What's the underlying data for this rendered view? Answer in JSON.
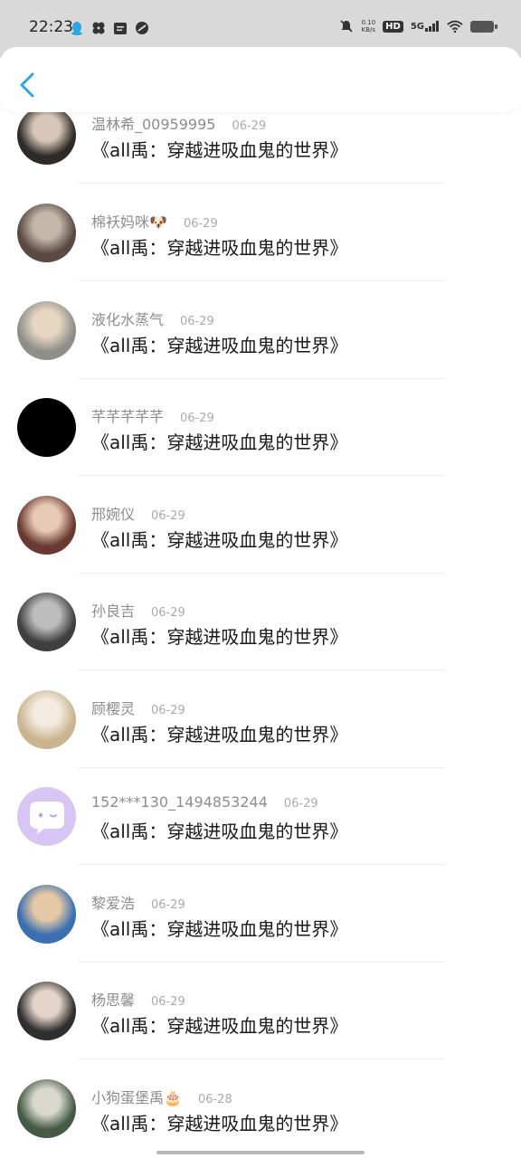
{
  "status_bar": {
    "time": "22:23",
    "net_speed_value": "0.10",
    "net_speed_unit": "KB/s",
    "hd": "HD",
    "signal": "5G"
  },
  "header": {
    "back_icon": "chevron-left-icon",
    "accent": "#2aa7df"
  },
  "messages": [
    {
      "user": "温林希_00959995",
      "date": "06-29",
      "text": "《all禹：穿越进吸血鬼的世界》",
      "avatar": "photo"
    },
    {
      "user": "棉袄妈咪🐶",
      "date": "06-29",
      "text": "《all禹：穿越进吸血鬼的世界》",
      "avatar": "photo"
    },
    {
      "user": "液化水蒸气",
      "date": "06-29",
      "text": "《all禹：穿越进吸血鬼的世界》",
      "avatar": "photo"
    },
    {
      "user": "芊芊芊芊芊",
      "date": "06-29",
      "text": "《all禹：穿越进吸血鬼的世界》",
      "avatar": "black"
    },
    {
      "user": "邢婉仪",
      "date": "06-29",
      "text": "《all禹：穿越进吸血鬼的世界》",
      "avatar": "photo"
    },
    {
      "user": "孙良吉",
      "date": "06-29",
      "text": "《all禹：穿越进吸血鬼的世界》",
      "avatar": "photo"
    },
    {
      "user": "顾樱灵",
      "date": "06-29",
      "text": "《all禹：穿越进吸血鬼的世界》",
      "avatar": "photo"
    },
    {
      "user": "152***130_1494853244",
      "date": "06-29",
      "text": "《all禹：穿越进吸血鬼的世界》",
      "avatar": "default"
    },
    {
      "user": "黎爱浩",
      "date": "06-29",
      "text": "《all禹：穿越进吸血鬼的世界》",
      "avatar": "photo"
    },
    {
      "user": "杨思馨",
      "date": "06-29",
      "text": "《all禹：穿越进吸血鬼的世界》",
      "avatar": "photo"
    },
    {
      "user": "小狗蛋堡禹🎂",
      "date": "06-28",
      "text": "《all禹：穿越进吸血鬼的世界》",
      "avatar": "photo"
    }
  ]
}
